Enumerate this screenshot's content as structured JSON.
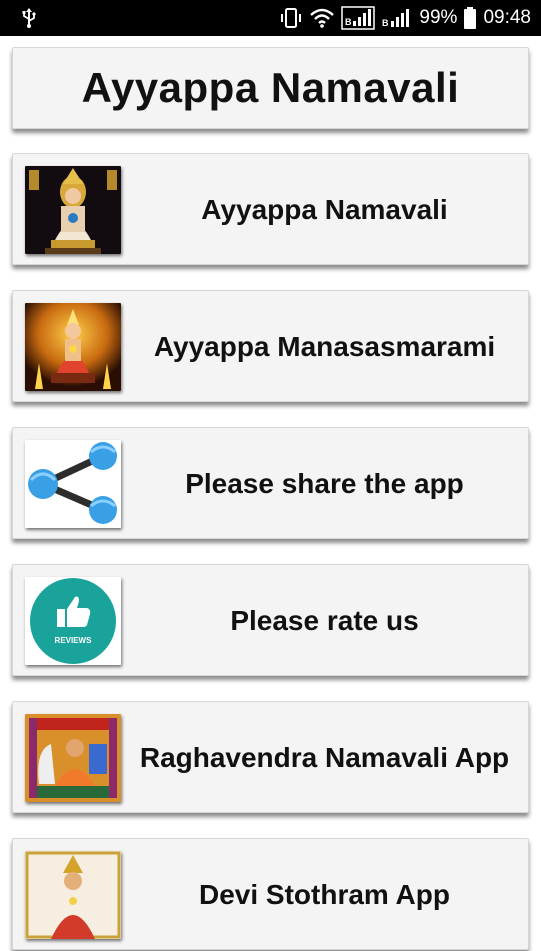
{
  "status_bar": {
    "usb_icon": "usb-icon",
    "battery_percent": "99%",
    "time": "09:48"
  },
  "header": {
    "title": "Ayyappa Namavali"
  },
  "menu_items": [
    {
      "label": "Ayyappa Namavali",
      "icon": "ayyappa-image-icon"
    },
    {
      "label": "Ayyappa Manasasmarami",
      "icon": "ayyappa-lamp-image-icon"
    },
    {
      "label": "Please share the app",
      "icon": "share-icon"
    },
    {
      "label": "Please rate us",
      "icon": "thumbs-up-reviews-icon",
      "icon_text": "REVIEWS"
    },
    {
      "label": "Raghavendra Namavali App",
      "icon": "raghavendra-image-icon"
    },
    {
      "label": "Devi Stothram App",
      "icon": "devi-image-icon"
    }
  ],
  "colors": {
    "status_bar": "#000000",
    "card_background": "#f4f4f4",
    "share_accent": "#3aa0e6",
    "reviews_teal": "#1aa39a"
  }
}
